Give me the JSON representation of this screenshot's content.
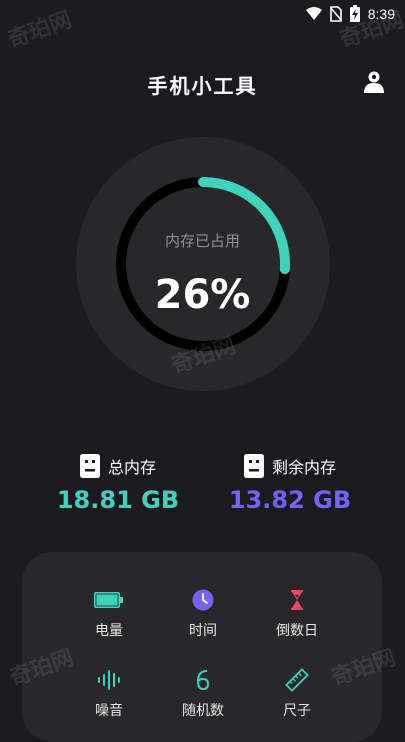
{
  "status_bar": {
    "time": "8:39"
  },
  "header": {
    "title": "手机小工具"
  },
  "memory_gauge": {
    "label": "内存已占用",
    "percent_text": "26%",
    "percent": 0.26,
    "arc_color": "#3fd2bd",
    "track_color": "#000000",
    "ring_bg": "#28282b"
  },
  "total_memory": {
    "label": "总内存",
    "value": "18.81 GB",
    "color": "#43d1bf"
  },
  "free_memory": {
    "label": "剩余内存",
    "value": "13.82 GB",
    "color": "#7264f2"
  },
  "tools": [
    {
      "label": "电量",
      "icon": "battery-icon"
    },
    {
      "label": "时间",
      "icon": "clock-icon"
    },
    {
      "label": "倒数日",
      "icon": "hourglass-icon"
    },
    {
      "label": "噪音",
      "icon": "sound-wave-icon"
    },
    {
      "label": "随机数",
      "icon": "random-number-icon"
    },
    {
      "label": "尺子",
      "icon": "ruler-icon"
    }
  ],
  "watermark": "奇珀网"
}
